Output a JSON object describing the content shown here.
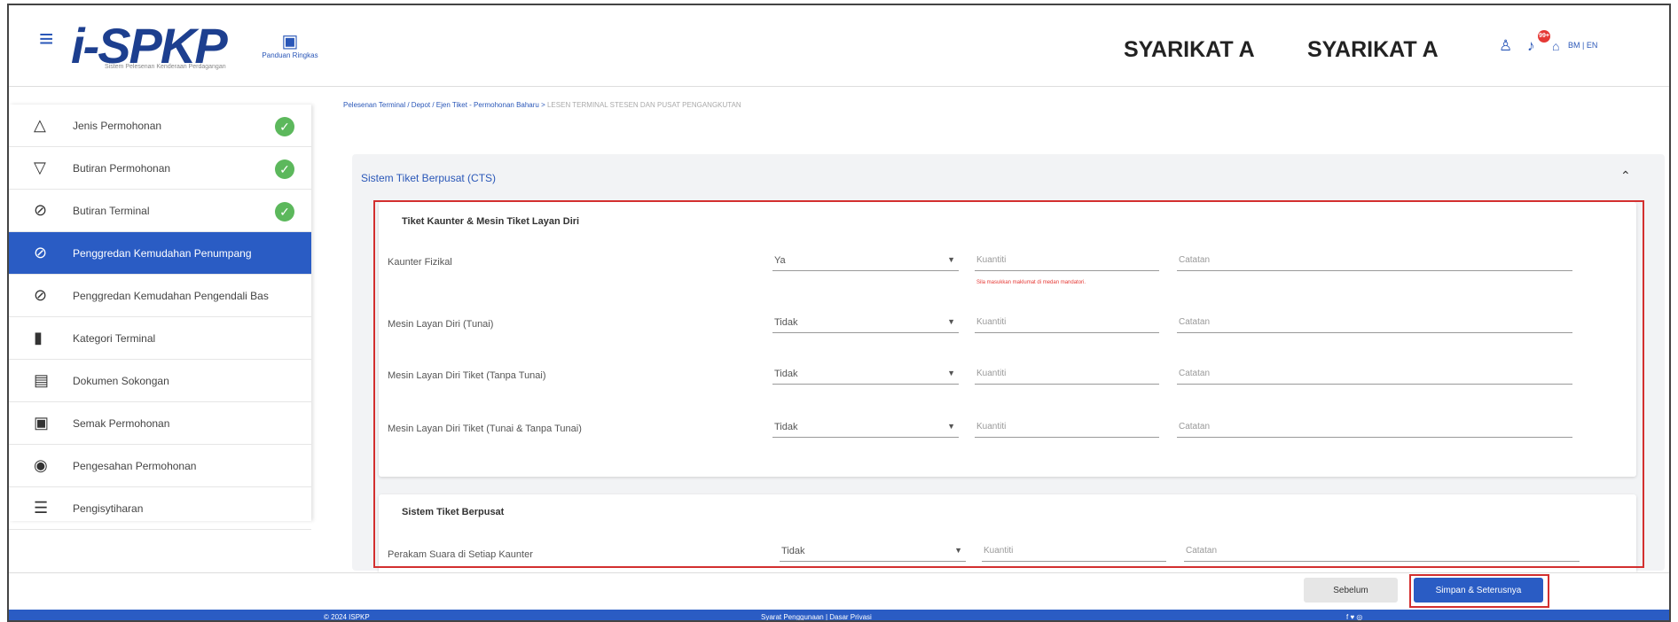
{
  "header": {
    "menu_icon": "hamburger-icon",
    "logo_text": "i-SPKP",
    "logo_subtitle": "Sistem Pelesenan Kenderaan Perdagangan",
    "panduan_label": "Panduan Ringkas",
    "company_1": "SYARIKAT A",
    "company_2": "SYARIKAT A",
    "notification_count": "99+",
    "lang": "BM | EN"
  },
  "sidebar": {
    "items": [
      {
        "label": "Jenis Permohonan",
        "icon": "triangle-icon",
        "done": true
      },
      {
        "label": "Butiran Permohonan",
        "icon": "filter-icon",
        "done": true
      },
      {
        "label": "Butiran Terminal",
        "icon": "check-circle-icon",
        "done": true
      },
      {
        "label": "Penggredan Kemudahan Penumpang",
        "icon": "check-circle-icon",
        "active": true
      },
      {
        "label": "Penggredan Kemudahan Pengendali Bas",
        "icon": "check-circle-icon"
      },
      {
        "label": "Kategori Terminal",
        "icon": "file-icon"
      },
      {
        "label": "Dokumen Sokongan",
        "icon": "document-icon"
      },
      {
        "label": "Semak Permohonan",
        "icon": "chat-icon"
      },
      {
        "label": "Pengesahan Permohonan",
        "icon": "circle-icon"
      },
      {
        "label": "Pengisytiharan",
        "icon": "list-icon"
      }
    ]
  },
  "breadcrumb": {
    "path": "Pelesenan Terminal / Depot / Ejen Tiket - Permohonan Baharu > ",
    "current": "LESEN TERMINAL STESEN DAN PUSAT PENGANGKUTAN"
  },
  "panel": {
    "title": "Sistem Tiket Berpusat (CTS)"
  },
  "section1": {
    "title": "Tiket Kaunter & Mesin Tiket Layan Diri",
    "rows": [
      {
        "label": "Kaunter Fizikal",
        "value": "Ya",
        "qty_placeholder": "Kuantiti",
        "note_placeholder": "Catatan",
        "error": "Sila masukkan maklumat di medan mandatori."
      },
      {
        "label": "Mesin Layan Diri (Tunai)",
        "value": "Tidak",
        "qty_placeholder": "Kuantiti",
        "note_placeholder": "Catatan"
      },
      {
        "label": "Mesin Layan Diri Tiket (Tanpa Tunai)",
        "value": "Tidak",
        "qty_placeholder": "Kuantiti",
        "note_placeholder": "Catatan"
      },
      {
        "label": "Mesin Layan Diri Tiket (Tunai & Tanpa Tunai)",
        "value": "Tidak",
        "qty_placeholder": "Kuantiti",
        "note_placeholder": "Catatan"
      }
    ]
  },
  "section2": {
    "title": "Sistem Tiket Berpusat",
    "rows": [
      {
        "label": "Perakam Suara di Setiap Kaunter",
        "value": "Tidak",
        "qty_placeholder": "Kuantiti",
        "note_placeholder": "Catatan"
      }
    ]
  },
  "actions": {
    "prev": "Sebelum",
    "next": "Simpan & Seterusnya"
  },
  "footer": {
    "copyright": "© 2024 ISPKP",
    "links": "Syarat Penggunaan | Dasar Privasi",
    "social": "f ♥ ◎"
  },
  "colors": {
    "primary": "#2a5cc4",
    "success": "#5cb85c",
    "highlight": "#d32f2f"
  }
}
